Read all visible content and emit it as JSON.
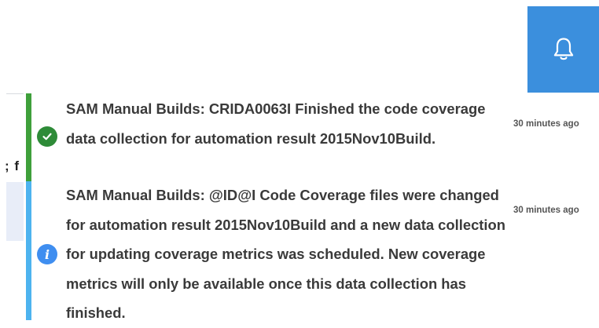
{
  "header": {
    "notifications_icon": "bell-icon",
    "accent_color": "#3b8fdd"
  },
  "sidebar": {
    "cut_text": "; f"
  },
  "notifications": [
    {
      "status": "success",
      "status_icon": "check-circle-icon",
      "status_color": "#3fa03b",
      "message": "SAM Manual Builds: CRIDA0063I Finished the code coverage data collection for automation result 2015Nov10Build.",
      "time": "30 minutes ago"
    },
    {
      "status": "info",
      "status_icon": "info-circle-icon",
      "status_color": "#4db3ef",
      "icon_glyph": "i",
      "message": "SAM Manual Builds: @ID@I Code Coverage files were changed for automation result 2015Nov10Build and a new data collection for updating coverage metrics was scheduled. New coverage metrics will only be available once this data collection has finished.",
      "time": "30 minutes ago"
    }
  ]
}
